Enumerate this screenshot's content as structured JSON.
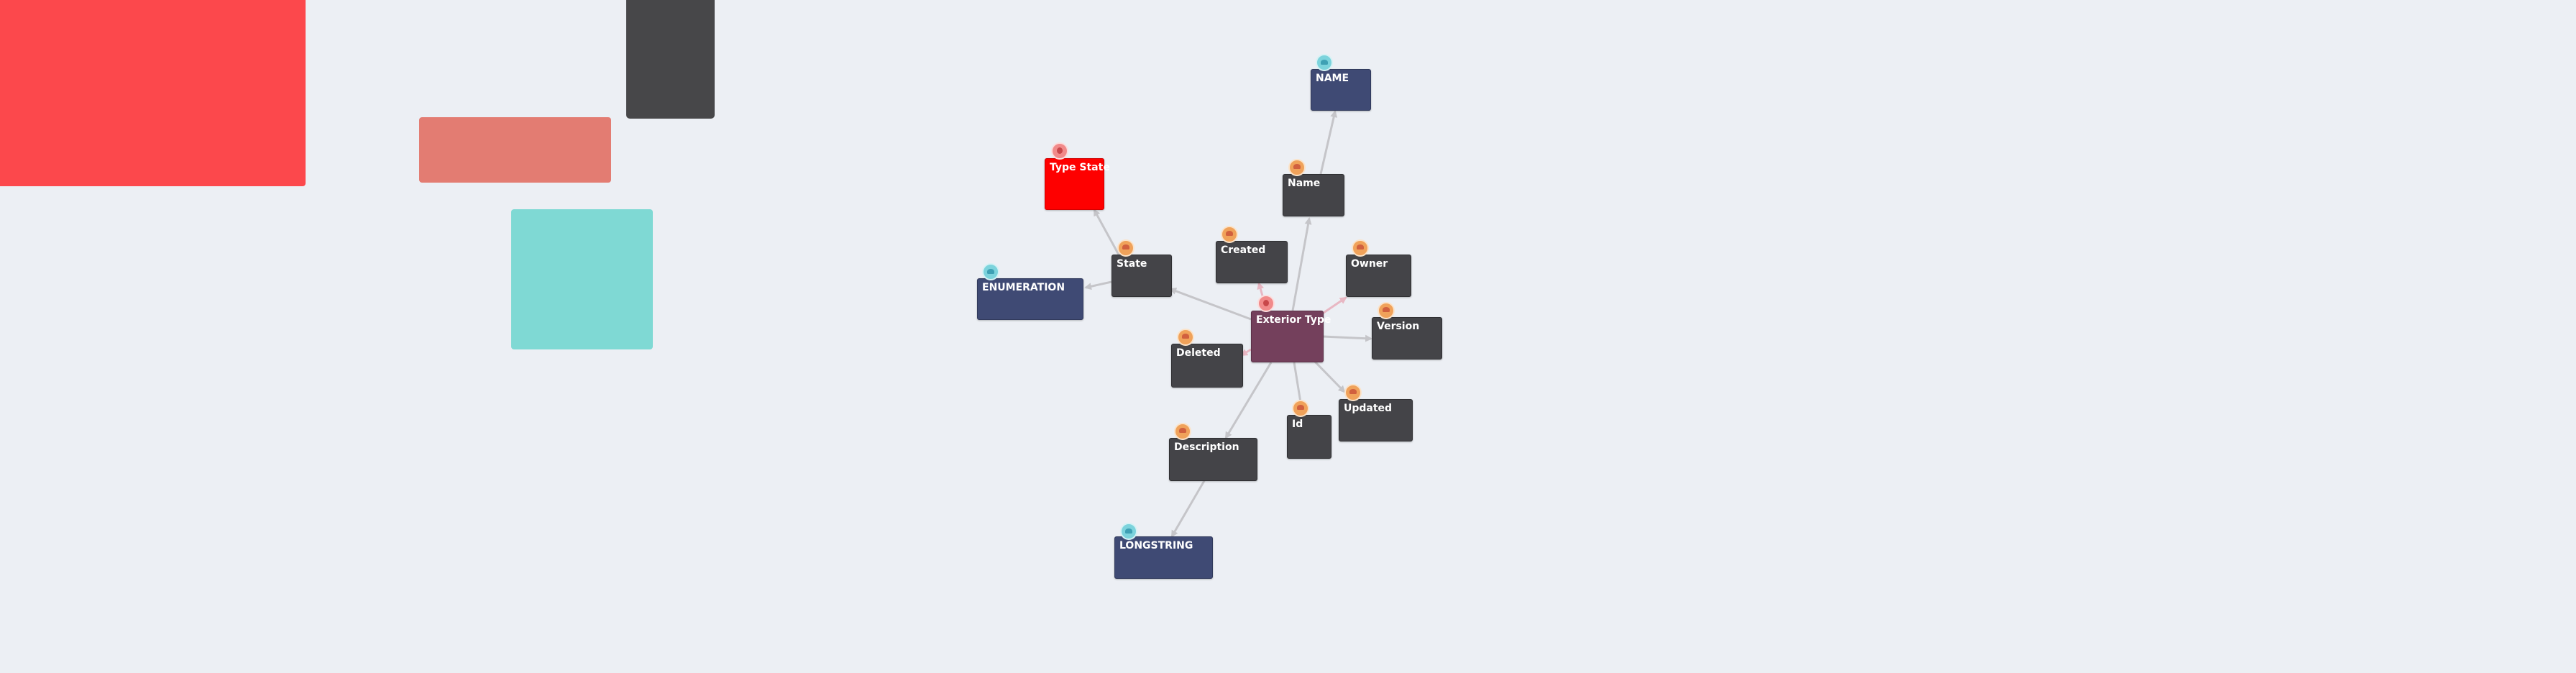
{
  "diagram": {
    "center": {
      "label": "Exterior Type"
    },
    "attributes": [
      {
        "id": "name",
        "label": "Name"
      },
      {
        "id": "created",
        "label": "Created"
      },
      {
        "id": "owner",
        "label": "Owner"
      },
      {
        "id": "state",
        "label": "State"
      },
      {
        "id": "version",
        "label": "Version"
      },
      {
        "id": "deleted",
        "label": "Deleted"
      },
      {
        "id": "updated",
        "label": "Updated"
      },
      {
        "id": "id",
        "label": "Id"
      },
      {
        "id": "description",
        "label": "Description"
      }
    ],
    "types": [
      {
        "id": "name-type",
        "label": "NAME"
      },
      {
        "id": "enumeration-type",
        "label": "ENUMERATION"
      },
      {
        "id": "longstring-type",
        "label": "LONGSTRING"
      }
    ],
    "related": [
      {
        "id": "type-state",
        "label": "Type State"
      }
    ],
    "edge_colors": {
      "gray": "#c5c5c9",
      "pink": "#e8b7c3"
    },
    "node_colors": {
      "attribute": "#444448",
      "type": "#3f4a74",
      "center": "#74405c",
      "highlight": "#fe0000"
    }
  },
  "background": {
    "canvas_color": "#eceff4",
    "panels": [
      {
        "id": "red-panel",
        "color": "#fc484c"
      },
      {
        "id": "dark-panel",
        "color": "#474749"
      },
      {
        "id": "salmon-panel",
        "color": "#e37c72"
      },
      {
        "id": "teal-panel",
        "color": "#7fd9d4"
      }
    ]
  }
}
